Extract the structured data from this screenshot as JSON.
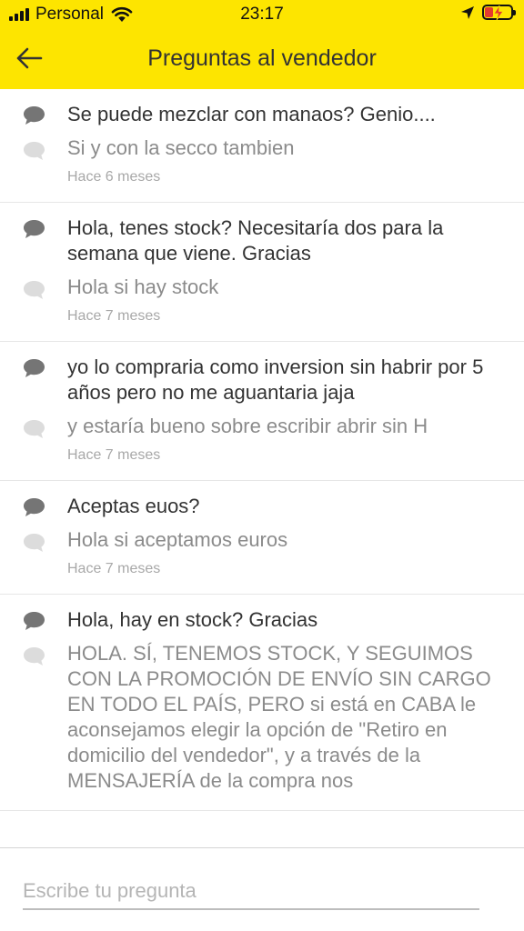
{
  "status_bar": {
    "carrier": "Personal",
    "time": "23:17",
    "signal_icon": "cellular-signal-icon",
    "wifi_icon": "wifi-icon",
    "location_icon": "location-arrow-icon",
    "battery_icon": "battery-charging-icon"
  },
  "header": {
    "title": "Preguntas al vendedor",
    "back_icon": "arrow-left-icon",
    "background_color": "#fde500"
  },
  "questions": [
    {
      "question": "Se puede mezclar con manaos?  Genio....",
      "answer": "Si y con la secco tambien",
      "date": "Hace 6 meses"
    },
    {
      "question": "Hola, tenes stock? Necesitaría dos para la semana que viene. Gracias",
      "answer": "Hola si hay stock",
      "date": "Hace 7 meses"
    },
    {
      "question": "yo lo compraria como inversion sin habrir por 5 años pero no me aguantaria jaja",
      "answer": "y estaría bueno sobre escribir abrir sin H",
      "date": "Hace 7 meses"
    },
    {
      "question": "Aceptas euos?",
      "answer": "Hola si aceptamos euros",
      "date": "Hace 7 meses"
    },
    {
      "question": "Hola, hay en stock? Gracias",
      "answer": "HOLA. SÍ, TENEMOS STOCK, Y SEGUIMOS CON LA PROMOCIÓN DE ENVÍO SIN CARGO EN TODO EL PAÍS, PERO si está en CABA le aconsejamos elegir la opción de \"Retiro en domicilio del vendedor\", y a través de la MENSAJERÍA de la compra nos",
      "date": ""
    }
  ],
  "footer": {
    "placeholder": "Escribe tu pregunta"
  }
}
